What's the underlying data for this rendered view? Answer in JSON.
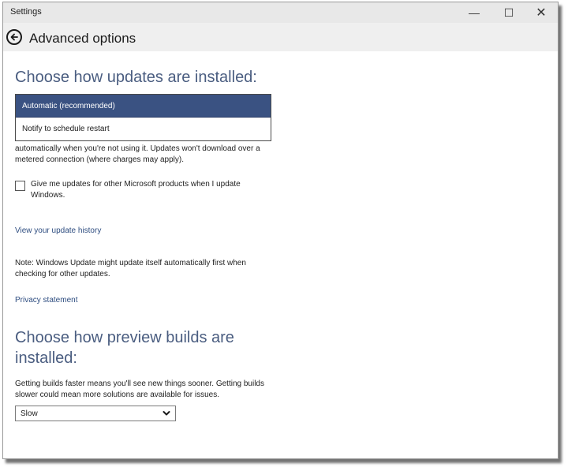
{
  "window": {
    "title": "Settings",
    "minimize_glyph": "—",
    "maximize_glyph": "☐",
    "close_glyph": "✕"
  },
  "header": {
    "title": "Advanced options",
    "back_icon": "back-arrow-icon"
  },
  "updates": {
    "heading": "Choose how updates are installed:",
    "options": [
      "Automatic (recommended)",
      "Notify to schedule restart"
    ],
    "selected": "Automatic (recommended)",
    "description": "automatically when you're not using it. Updates won't download over a metered connection (where charges may apply)."
  },
  "other_products": {
    "checked": false,
    "label": "Give me updates for other Microsoft products when I update Windows."
  },
  "links": {
    "history": "View your update history",
    "privacy": "Privacy statement"
  },
  "note": "Note: Windows Update might update itself automatically first when checking for other updates.",
  "preview": {
    "heading": "Choose how preview builds are installed:",
    "description": "Getting builds faster means you'll see new things sooner. Getting builds slower could mean more solutions are available for issues.",
    "selected": "Slow"
  },
  "colors": {
    "accent": "#3a5282",
    "heading": "#4a5d80",
    "link": "#2e4d80"
  }
}
